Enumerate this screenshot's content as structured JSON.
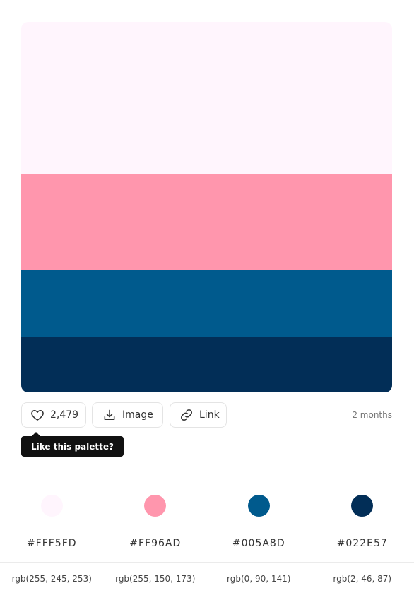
{
  "palette": {
    "colors": [
      {
        "hex_label": "#FFF5FD",
        "rgb_label": "rgb(255, 245, 253)",
        "color": "#FFF5FD",
        "share": 0.41
      },
      {
        "hex_label": "#FF96AD",
        "rgb_label": "rgb(255, 150, 173)",
        "color": "#FF96AD",
        "share": 0.26
      },
      {
        "hex_label": "#005A8D",
        "rgb_label": "rgb(0, 90, 141)",
        "color": "#005A8D",
        "share": 0.18
      },
      {
        "hex_label": "#022E57",
        "rgb_label": "rgb(2, 46, 87)",
        "color": "#022E57",
        "share": 0.15
      }
    ]
  },
  "actions": {
    "like_count": "2,479",
    "image_label": "Image",
    "link_label": "Link",
    "time_ago": "2 months"
  },
  "tooltip": {
    "text": "Like this palette?"
  },
  "icons": {
    "like": "heart-icon",
    "image": "download-icon",
    "link": "link-icon"
  }
}
